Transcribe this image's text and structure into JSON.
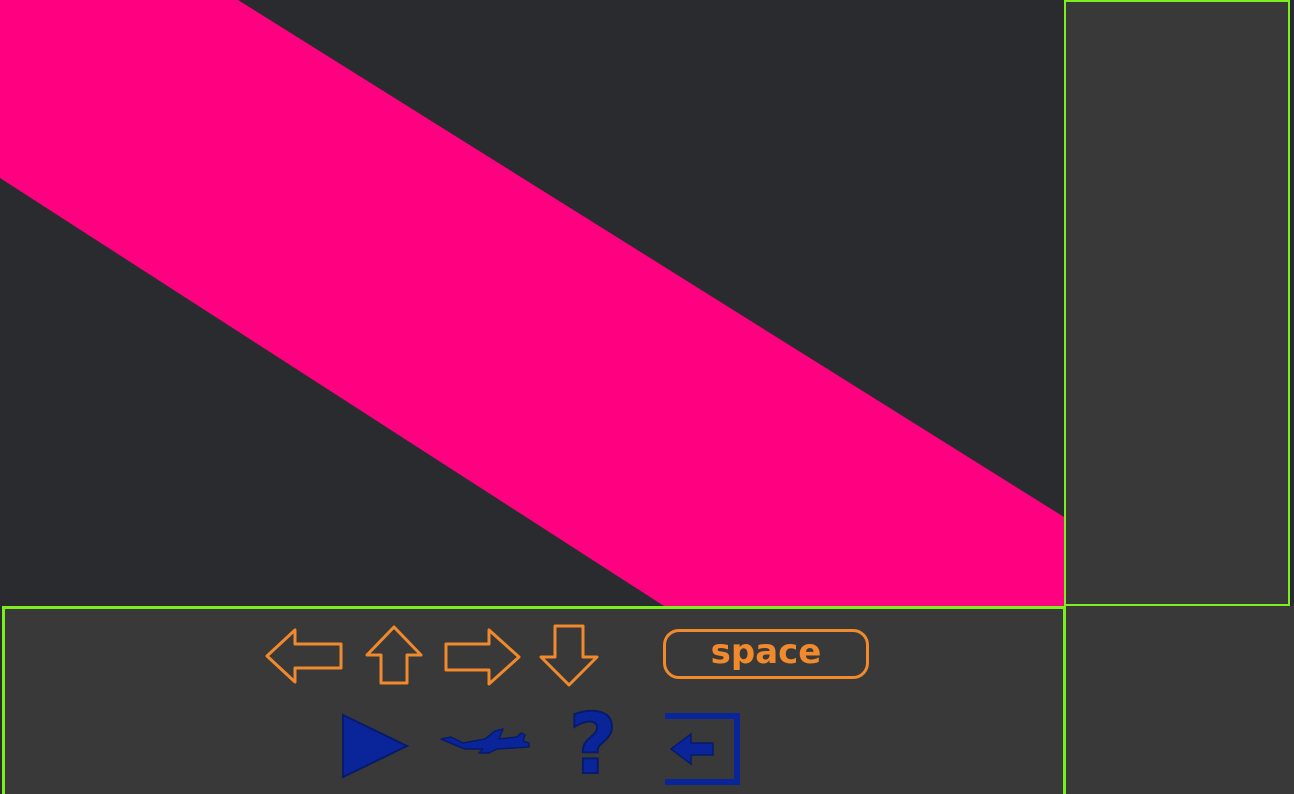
{
  "colors": {
    "background": "#2a2b2e",
    "panel": "#393939",
    "frame": "#7cf01b",
    "road": "#ff0080",
    "key_outline": "#f08a2c",
    "button_blue": "#0a259a"
  },
  "controls": {
    "keys": [
      {
        "name": "left-arrow-key-icon"
      },
      {
        "name": "up-arrow-key-icon"
      },
      {
        "name": "right-arrow-key-icon"
      },
      {
        "name": "down-arrow-key-icon"
      }
    ],
    "space_label": "space"
  },
  "buttons": [
    {
      "name": "play-icon"
    },
    {
      "name": "airplane-icon"
    },
    {
      "name": "help-icon",
      "text": "?"
    },
    {
      "name": "exit-icon"
    }
  ]
}
